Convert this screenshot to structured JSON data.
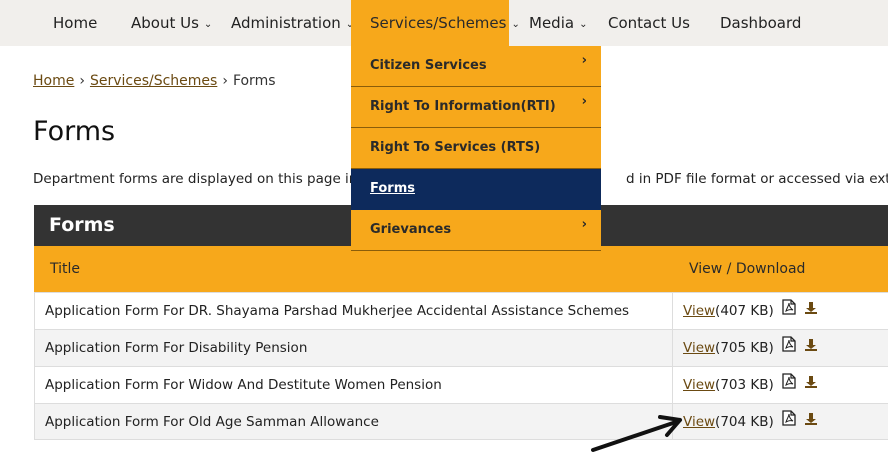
{
  "nav": {
    "items": [
      {
        "label": "Home"
      },
      {
        "label": "About Us",
        "chevron": "⌄"
      },
      {
        "label": "Administration",
        "chevron": "⌄"
      },
      {
        "label": "Services/Schemes",
        "chevron": "⌄"
      },
      {
        "label": "Media",
        "chevron": "⌄"
      },
      {
        "label": "Contact Us"
      },
      {
        "label": "Dashboard"
      }
    ]
  },
  "breadcrumb": {
    "home": "Home",
    "sep1": "›",
    "services": "Services/Schemes",
    "sep2": "›",
    "current": "Forms"
  },
  "page": {
    "title": "Forms",
    "description_left": "Department forms are displayed on this page in t",
    "description_right": "d in PDF file format or accessed via external"
  },
  "dropdown": {
    "items": [
      {
        "label": "Citizen Services",
        "arrow": "›"
      },
      {
        "label": "Right To Information(RTI)",
        "arrow": "›"
      },
      {
        "label": "Right To Services (RTS)",
        "arrow": ""
      },
      {
        "label": "Forms",
        "arrow": ""
      },
      {
        "label": "Grievances",
        "arrow": "›"
      }
    ]
  },
  "table": {
    "panel_title": "Forms",
    "col_title": "Title",
    "col_download": "View / Download",
    "view_label": "View",
    "rows": [
      {
        "title": "Application Form For DR. Shayama Parshad Mukherjee Accidental Assistance Schemes",
        "size": "(407 KB)"
      },
      {
        "title": "Application Form For Disability Pension",
        "size": "(705 KB)"
      },
      {
        "title": "Application Form For Widow And Destitute Women Pension",
        "size": "(703 KB)"
      },
      {
        "title": "Application Form For Old Age Samman Allowance",
        "size": "(704 KB)"
      }
    ]
  },
  "colors": {
    "accent": "#f7a81b",
    "dark_header": "#333333",
    "selected_menu": "#0d2a5c",
    "link": "#6b4a12"
  },
  "icons": {
    "pdf": "pdf-icon",
    "download": "download-icon",
    "chevron": "chevron-down-icon",
    "arrow": "arrow-annotation"
  }
}
